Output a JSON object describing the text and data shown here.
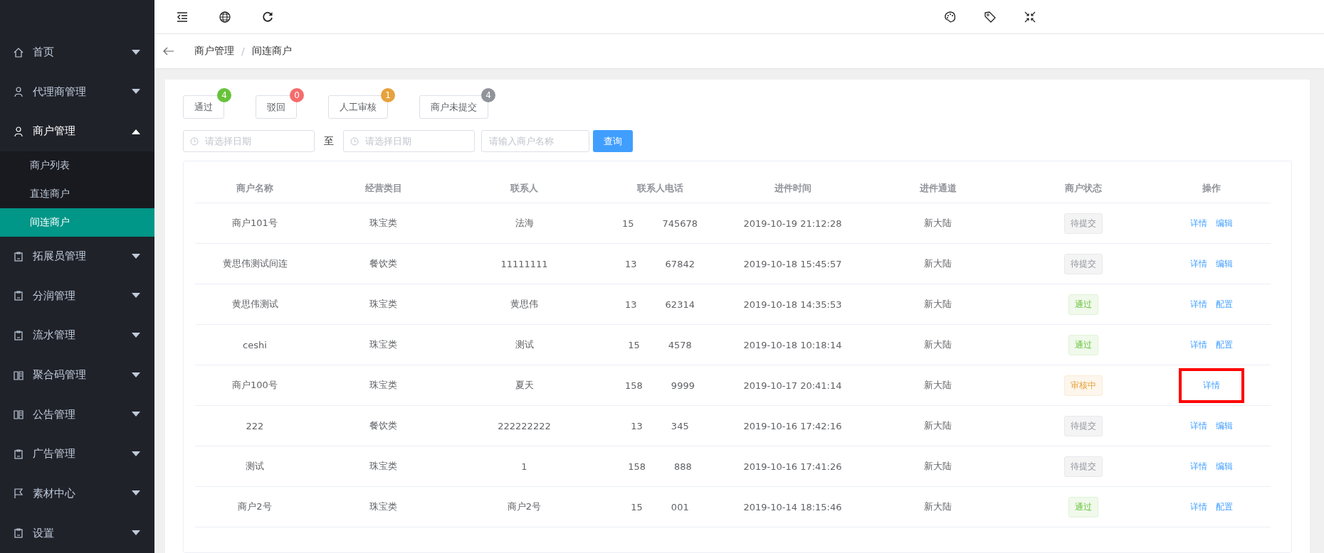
{
  "sidebar": {
    "items": [
      {
        "label": "首页",
        "expanded": false
      },
      {
        "label": "代理商管理",
        "expanded": false
      },
      {
        "label": "商户管理",
        "expanded": true,
        "children": [
          {
            "label": "商户列表",
            "selected": false
          },
          {
            "label": "直连商户",
            "selected": false
          },
          {
            "label": "间连商户",
            "selected": true
          }
        ]
      },
      {
        "label": "拓展员管理",
        "expanded": false
      },
      {
        "label": "分润管理",
        "expanded": false
      },
      {
        "label": "流水管理",
        "expanded": false
      },
      {
        "label": "聚合码管理",
        "expanded": false
      },
      {
        "label": "公告管理",
        "expanded": false
      },
      {
        "label": "广告管理",
        "expanded": false
      },
      {
        "label": "素材中心",
        "expanded": false
      },
      {
        "label": "设置",
        "expanded": false
      }
    ]
  },
  "breadcrumb": {
    "items": [
      "商户管理",
      "间连商户"
    ],
    "separator": "/"
  },
  "status_tabs": [
    {
      "label": "通过",
      "count": "4",
      "color": "#67c23a"
    },
    {
      "label": "驳回",
      "count": "0",
      "color": "#f56c6c"
    },
    {
      "label": "人工审核",
      "count": "1",
      "color": "#e6a23c"
    },
    {
      "label": "商户未提交",
      "count": "4",
      "color": "#909399"
    }
  ],
  "filters": {
    "start_date": {
      "placeholder": "请选择日期"
    },
    "separator": "至",
    "end_date": {
      "placeholder": "请选择日期"
    },
    "name": {
      "placeholder": "请输入商户名称"
    },
    "search_button": "查询"
  },
  "table": {
    "columns": [
      "商户名称",
      "经营类目",
      "联系人",
      "联系人电话",
      "进件时间",
      "进件通道",
      "商户状态",
      "操作"
    ],
    "rows": [
      {
        "name": "商户101号",
        "category": "珠宝类",
        "contact": "法海",
        "phone_start": "15",
        "phone_end": "745678",
        "time": "2019-10-19 21:12:28",
        "channel": "新大陆",
        "status": "待提交",
        "kind": "pending",
        "actions": [
          "详情",
          "编辑"
        ],
        "highlighted": false
      },
      {
        "name": "黄思伟测试间连",
        "category": "餐饮类",
        "contact": "11111111",
        "phone_start": "13",
        "phone_end": "67842",
        "time": "2019-10-18 15:45:57",
        "channel": "新大陆",
        "status": "待提交",
        "kind": "pending",
        "actions": [
          "详情",
          "编辑"
        ],
        "highlighted": false
      },
      {
        "name": "黄思伟测试",
        "category": "珠宝类",
        "contact": "黄思伟",
        "phone_start": "13",
        "phone_end": "62314",
        "time": "2019-10-18 14:35:53",
        "channel": "新大陆",
        "status": "通过",
        "kind": "passed",
        "actions": [
          "详情",
          "配置"
        ],
        "highlighted": false
      },
      {
        "name": "ceshi",
        "category": "珠宝类",
        "contact": "测试",
        "phone_start": "15",
        "phone_end": "4578",
        "time": "2019-10-18 10:18:14",
        "channel": "新大陆",
        "status": "通过",
        "kind": "passed",
        "actions": [
          "详情",
          "配置"
        ],
        "highlighted": false
      },
      {
        "name": "商户100号",
        "category": "珠宝类",
        "contact": "夏天",
        "phone_start": "158",
        "phone_end": "9999",
        "time": "2019-10-17 20:41:14",
        "channel": "新大陆",
        "status": "审核中",
        "kind": "reviewing",
        "actions": [
          "详情"
        ],
        "highlighted": true
      },
      {
        "name": "222",
        "category": "餐饮类",
        "contact": "222222222",
        "phone_start": "13",
        "phone_end": "345",
        "time": "2019-10-16 17:42:16",
        "channel": "新大陆",
        "status": "待提交",
        "kind": "pending",
        "actions": [
          "详情",
          "编辑"
        ],
        "highlighted": false
      },
      {
        "name": "测试",
        "category": "珠宝类",
        "contact": "1",
        "phone_start": "158",
        "phone_end": "888",
        "time": "2019-10-16 17:41:26",
        "channel": "新大陆",
        "status": "待提交",
        "kind": "pending",
        "actions": [
          "详情",
          "编辑"
        ],
        "highlighted": false
      },
      {
        "name": "商户2号",
        "category": "珠宝类",
        "contact": "商户2号",
        "phone_start": "15",
        "phone_end": "001",
        "time": "2019-10-14 18:15:46",
        "channel": "新大陆",
        "status": "通过",
        "kind": "passed",
        "actions": [
          "详情",
          "配置"
        ],
        "highlighted": false
      }
    ]
  }
}
